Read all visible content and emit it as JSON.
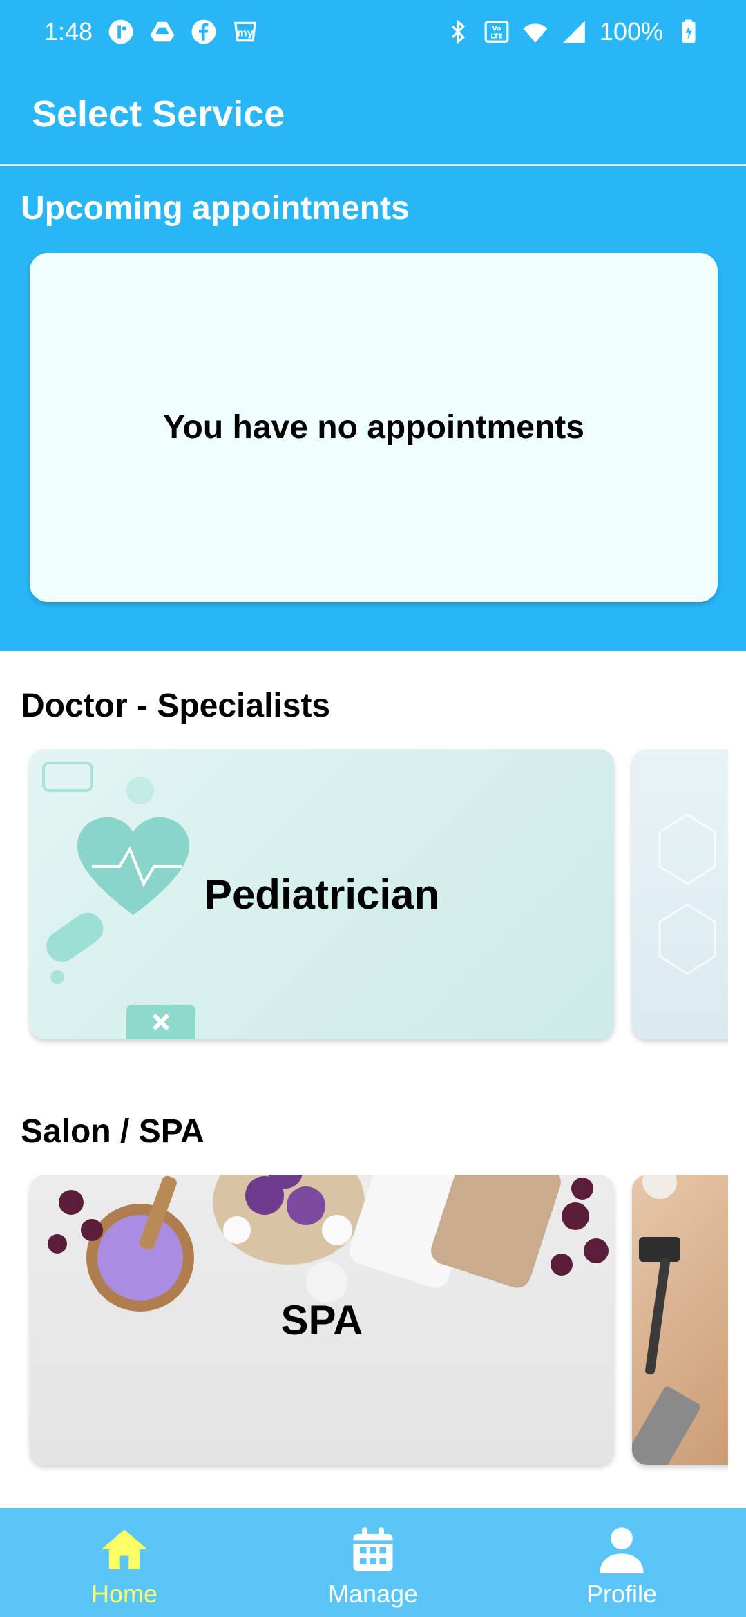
{
  "status_bar": {
    "time": "1:48",
    "battery": "100%",
    "left_icons": [
      "notification-app-icon",
      "drive-icon",
      "facebook-icon",
      "myntra-icon"
    ],
    "right_icons": [
      "bluetooth-icon",
      "volte-icon",
      "wifi-icon",
      "signal-icon",
      "battery-charging-icon"
    ]
  },
  "app_bar": {
    "title": "Select Service"
  },
  "upcoming": {
    "title": "Upcoming appointments",
    "empty_message": "You have no appointments"
  },
  "sections": [
    {
      "title": "Doctor - Specialists",
      "cards": [
        {
          "label": "Pediatrician"
        },
        {
          "label": ""
        }
      ]
    },
    {
      "title": "Salon / SPA",
      "cards": [
        {
          "label": "SPA"
        },
        {
          "label": ""
        }
      ]
    }
  ],
  "bottom_nav": {
    "items": [
      {
        "label": "Home",
        "icon": "home-icon",
        "active": true
      },
      {
        "label": "Manage",
        "icon": "calendar-icon",
        "active": false
      },
      {
        "label": "Profile",
        "icon": "person-icon",
        "active": false
      }
    ]
  },
  "colors": {
    "primary": "#29b6f6",
    "nav_bg": "#5bc5f7",
    "nav_active": "#ffff66",
    "card_bg": "#efffff"
  }
}
